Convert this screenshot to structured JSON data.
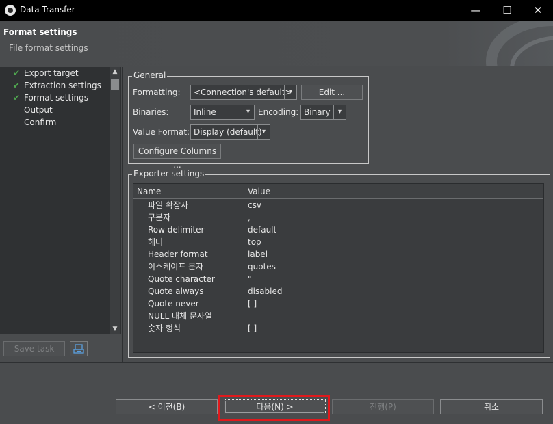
{
  "window": {
    "title": "Data Transfer",
    "minimize_glyph": "—",
    "maximize_glyph": "☐",
    "close_glyph": "✕"
  },
  "banner": {
    "heading": "Format settings",
    "subtitle": "File format settings"
  },
  "steps": [
    {
      "label": "Export target",
      "done": true
    },
    {
      "label": "Extraction settings",
      "done": true
    },
    {
      "label": "Format settings",
      "done": true
    },
    {
      "label": "Output",
      "done": false
    },
    {
      "label": "Confirm",
      "done": false
    }
  ],
  "left_bottom": {
    "save_task": "Save task",
    "task_icon": "task-config-icon"
  },
  "general": {
    "title": "General",
    "formatting_label": "Formatting:",
    "formatting_value": "<Connection's default>",
    "edit_button": "Edit ...",
    "binaries_label": "Binaries:",
    "binaries_value": "Inline",
    "encoding_label": "Encoding:",
    "encoding_value": "Binary",
    "value_format_label": "Value Format:",
    "value_format_value": "Display (default)",
    "configure_columns": "Configure Columns ..."
  },
  "exporter": {
    "title": "Exporter settings",
    "columns": [
      "Name",
      "Value"
    ],
    "rows": [
      {
        "name": "파일 확장자",
        "value": "csv"
      },
      {
        "name": "구분자",
        "value": ","
      },
      {
        "name": "Row delimiter",
        "value": "default"
      },
      {
        "name": "헤더",
        "value": "top"
      },
      {
        "name": "Header format",
        "value": "label"
      },
      {
        "name": "이스케이프 문자",
        "value": "quotes"
      },
      {
        "name": "Quote character",
        "value": "\""
      },
      {
        "name": "Quote always",
        "value": "disabled"
      },
      {
        "name": "Quote never",
        "value": "[ ]"
      },
      {
        "name": "NULL 대체 문자열",
        "value": ""
      },
      {
        "name": "숫자 형식",
        "value": "[ ]"
      }
    ]
  },
  "footer": {
    "back": "< 이전(B)",
    "next": "다음(N) >",
    "proceed": "진행(P)",
    "cancel": "취소"
  },
  "colors": {
    "check": "#4fa64f",
    "highlight": "#e0191c"
  }
}
